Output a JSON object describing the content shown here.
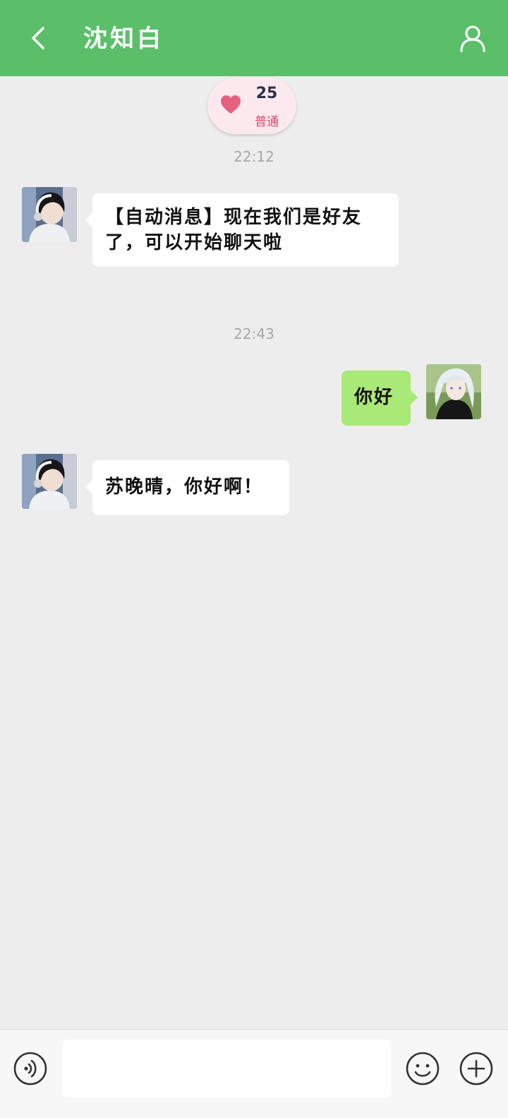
{
  "header": {
    "title": "沈知白",
    "back_icon": "chevron-left-icon",
    "profile_icon": "person-icon",
    "background_color": "#5bbf6a"
  },
  "intimacy": {
    "icon": "heart-icon",
    "count": "25",
    "level": "普通",
    "heart_color": "#e8607f"
  },
  "messages": [
    {
      "time": "22:12",
      "side": "left",
      "text": "【自动消息】现在我们是好友了，可以开始聊天啦"
    },
    {
      "time": "22:43",
      "side": "right",
      "text": "你好"
    },
    {
      "side": "left",
      "text": "苏晚晴，你好啊！"
    }
  ],
  "input_bar": {
    "value": "",
    "voice_icon": "voice-icon",
    "emoji_icon": "smiley-icon",
    "plus_icon": "plus-circle-icon"
  },
  "colors": {
    "chat_background": "#ededed",
    "sent_bubble": "#a9e978",
    "received_bubble": "#ffffff"
  }
}
